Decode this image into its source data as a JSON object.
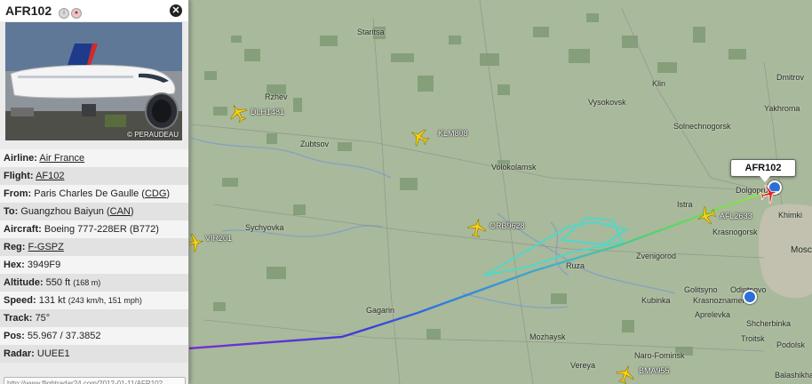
{
  "panel": {
    "flight_title": "AFR102",
    "photo_credit": "© PERAUDEAU",
    "url_text": "http://www.flightradar24.com/2012-01-11/AFR102",
    "rows": [
      {
        "label": "Airline:",
        "link": "Air France"
      },
      {
        "label": "Flight:",
        "link": "AF102"
      },
      {
        "label": "From:",
        "text": "Paris Charles De Gaulle (",
        "link": "CDG",
        "after": ")"
      },
      {
        "label": "To:",
        "text": "Guangzhou Baiyun (",
        "link": "CAN",
        "after": ")"
      },
      {
        "label": "Aircraft:",
        "text": "Boeing 777-228ER (B772)"
      },
      {
        "label": "Reg:",
        "link": "F-GSPZ"
      },
      {
        "label": "Hex:",
        "text": "3949F9"
      },
      {
        "label": "Altitude:",
        "text": "550 ft",
        "small": "(168 m)"
      },
      {
        "label": "Speed:",
        "text": "131 kt",
        "small": "(243 km/h, 151 mph)"
      },
      {
        "label": "Track:",
        "text": "75°"
      },
      {
        "label": "Pos:",
        "text": "55.967 / 37.3852"
      },
      {
        "label": "Radar:",
        "text": "UUEE1"
      }
    ]
  },
  "callout": {
    "label": "AFR102"
  },
  "aircraft_labels": {
    "dlh": "DLH1481",
    "klm": "KLM808",
    "orb": "ORB9628",
    "vir": "VIR201",
    "afl": "AFL2633",
    "bma": "BMA955"
  },
  "places": {
    "staritsa": "Staritsa",
    "rzhev": "Rzhev",
    "zubtsov": "Zubtsov",
    "klin": "Klin",
    "vysokovsk": "Vysokovsk",
    "solnechnogorsk": "Solnechnogorsk",
    "dmitrov": "Dmitrov",
    "yakhroma": "Yakhroma",
    "volokolamsk": "Volokolamsk",
    "istra": "Istra",
    "khimki": "Khimki",
    "krasnogorsk": "Krasnogorsk",
    "moscow": "Mosc",
    "sychyovka": "Sychyovka",
    "ruza": "Ruza",
    "zvenigorod": "Zvenigorod",
    "kubinka": "Kubinka",
    "golitsyno": "Golitsyno",
    "odintsovo": "Odintsovo",
    "krasnoznamensk": "Krasnoznamensk",
    "aprelevka": "Aprelevka",
    "shcherbinka": "Shcherbinka",
    "troitsk": "Troitsk",
    "podolsk": "Podolsk",
    "gagarin": "Gagarin",
    "mozhaysk": "Mozhaysk",
    "naro_fominsk": "Naro-Fominsk",
    "vereya": "Vereya",
    "dolgoprudny": "Dolgoprudny",
    "balashikha": "Balashikha"
  },
  "colors": {
    "plane_yellow": "#f5d214",
    "plane_selected": "#d9221f",
    "track_cyan": "#4fd8c8",
    "airport_blue": "#2b6fd8"
  }
}
